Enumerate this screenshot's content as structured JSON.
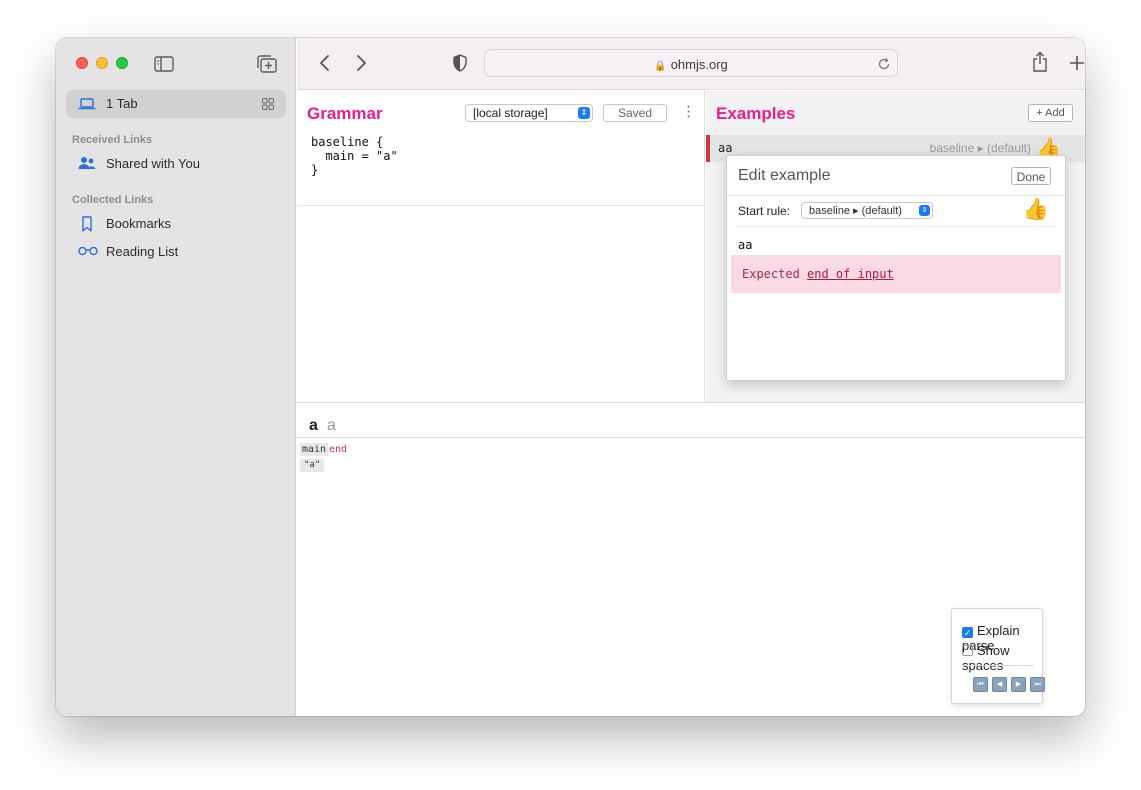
{
  "sidebar": {
    "tab_label": "1 Tab",
    "received_header": "Received Links",
    "shared_label": "Shared with You",
    "collected_header": "Collected Links",
    "bookmarks_label": "Bookmarks",
    "reading_list_label": "Reading List"
  },
  "toolbar": {
    "url": "ohmjs.org"
  },
  "grammar": {
    "title": "Grammar",
    "storage_select": "[local storage]",
    "saved_label": "Saved",
    "code": "baseline {\n  main = \"a\"\n}"
  },
  "examples": {
    "title": "Examples",
    "add_label": "+ Add",
    "row_text": "aa",
    "row_rule": "baseline ▸ (default)"
  },
  "edit_example": {
    "title": "Edit example",
    "done_label": "Done",
    "start_rule_label": "Start rule:",
    "start_rule_value": "baseline ▸ (default)",
    "input_text": "aa",
    "error_prefix": "Expected ",
    "error_link": "end of input"
  },
  "trace": {
    "char1": "a",
    "char2": "a",
    "rule_main": "main",
    "rule_end": "end",
    "literal": "\"a\""
  },
  "options": {
    "explain_parse": "Explain parse",
    "explain_parse_checked": true,
    "show_spaces": "Show spaces",
    "show_spaces_checked": false
  }
}
